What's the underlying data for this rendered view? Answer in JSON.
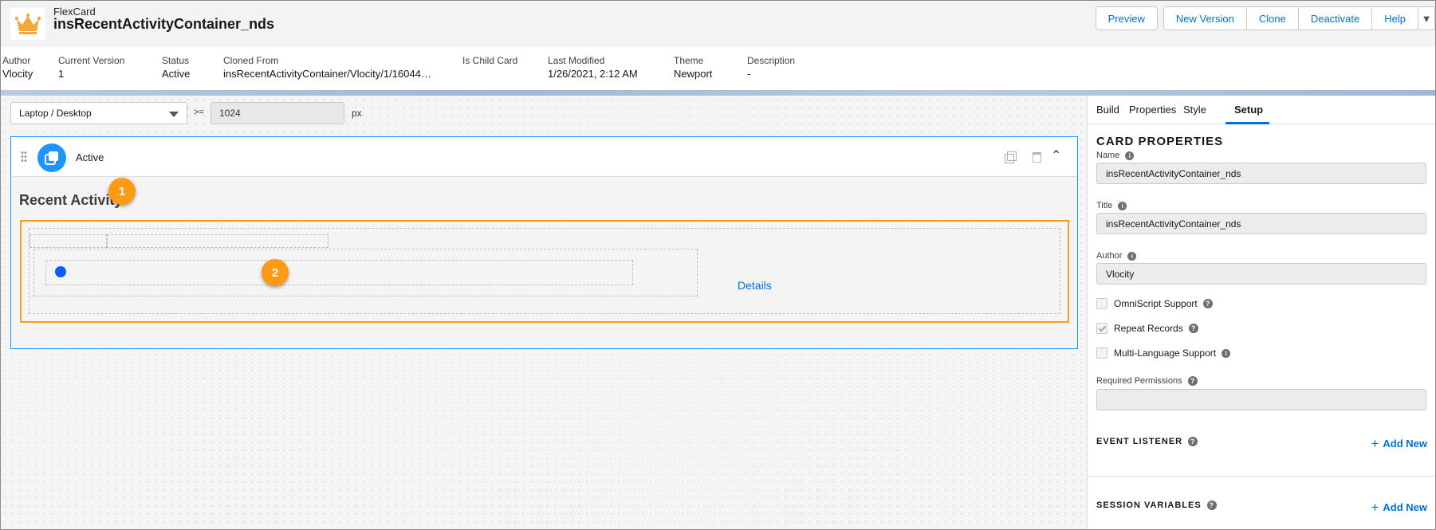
{
  "header": {
    "eyebrow": "FlexCard",
    "title": "insRecentActivityContainer_nds",
    "buttons": [
      "Preview",
      "New Version",
      "Clone",
      "Deactivate",
      "Help"
    ],
    "menu_icon": "chevron-down-icon"
  },
  "info": {
    "author_label": "Author",
    "author": "Vlocity",
    "version_label": "Current Version",
    "version": "1",
    "status_label": "Status",
    "status": "Active",
    "cloned_label": "Cloned From",
    "cloned": "insRecentActivityContainer/Vlocity/1/16044…",
    "child_label": "Is Child Card",
    "child": "",
    "modified_label": "Last Modified",
    "modified": "1/26/2021, 2:12 AM",
    "theme_label": "Theme",
    "theme": "Newport",
    "desc_label": "Description",
    "desc": "-"
  },
  "canvas": {
    "device": "Laptop / Desktop",
    "gte": ">=",
    "width_value": "1024",
    "unit": "px",
    "state_label": "Active",
    "heading": "Recent Activity",
    "details_link": "Details",
    "badge1": "1",
    "badge2": "2"
  },
  "panel": {
    "tabs": [
      "Build",
      "Properties",
      "Style",
      "Setup"
    ],
    "active_tab": "Setup",
    "section_title": "CARD PROPERTIES",
    "name_label": "Name",
    "name_value": "insRecentActivityContainer_nds",
    "title_label": "Title",
    "title_value": "insRecentActivityContainer_nds",
    "author_label": "Author",
    "author_value": "Vlocity",
    "omniscript": {
      "label": "OmniScript Support",
      "checked": false
    },
    "repeat": {
      "label": "Repeat Records",
      "checked": true
    },
    "multilang": {
      "label": "Multi-Language Support",
      "checked": false
    },
    "permissions_label": "Required Permissions",
    "permissions_value": "",
    "event_listener": "EVENT LISTENER",
    "session_variables": "SESSION VARIABLES",
    "add_new": "Add New"
  },
  "colors": {
    "accent": "#0070d2",
    "brand_blue": "#1b96ff",
    "highlight": "#ff9a14",
    "crown": "#f4a73a"
  }
}
